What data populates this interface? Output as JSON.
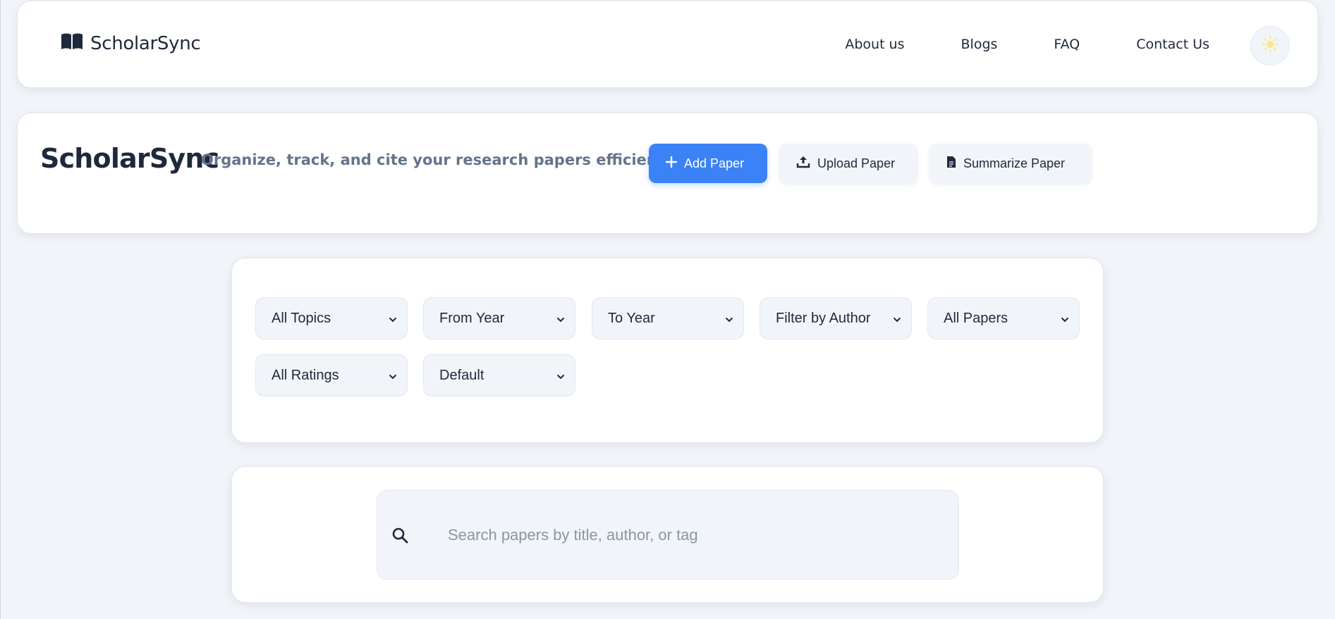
{
  "navbar": {
    "brand": "ScholarSync",
    "brand_icon": "book-open-icon",
    "links": [
      "About us",
      "Blogs",
      "FAQ",
      "Contact Us"
    ],
    "theme_icon": "sun-icon",
    "theme_icon_color": "#fde68a"
  },
  "hero": {
    "title": "ScholarSync",
    "subtitle": "Organize, track, and cite your research papers efficiently",
    "buttons": {
      "add": {
        "label": "Add Paper",
        "icon": "plus-icon"
      },
      "upload": {
        "label": "Upload Paper",
        "icon": "upload-icon"
      },
      "summarize": {
        "label": "Summarize Paper",
        "icon": "file-text-icon"
      }
    }
  },
  "filters": {
    "topics": "All Topics",
    "from_year": "From Year",
    "to_year": "To Year",
    "author": "Filter by Author",
    "papers": "All Papers",
    "ratings": "All Ratings",
    "sort": "Default"
  },
  "search": {
    "placeholder": "Search papers by title, author, or tag",
    "value": ""
  },
  "colors": {
    "accent": "#3b82f6",
    "background": "#f1f4f8",
    "text": "#1e293b",
    "muted": "#64748b"
  }
}
